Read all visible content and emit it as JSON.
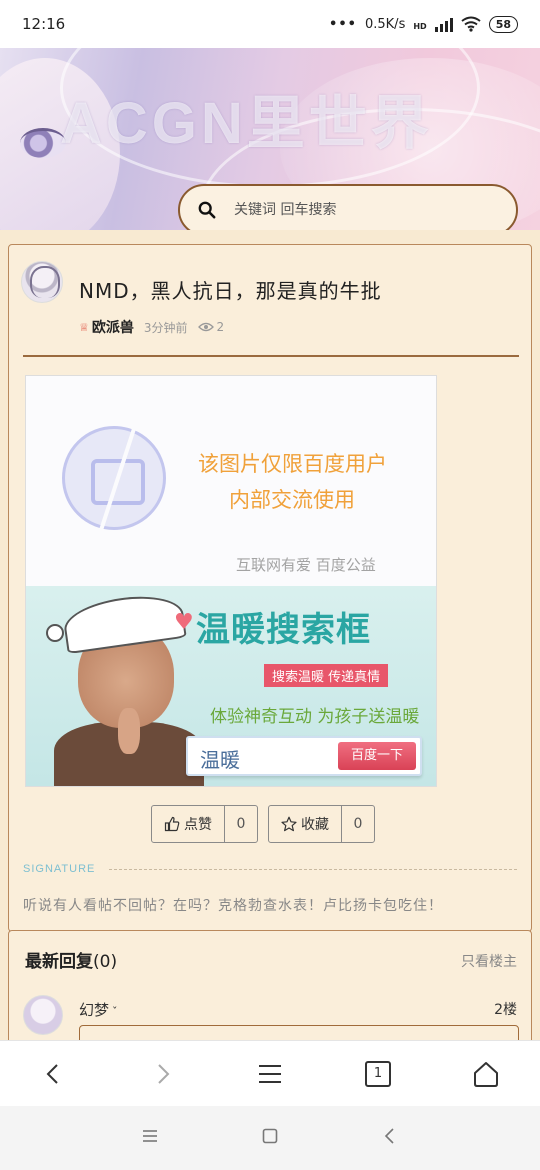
{
  "status_bar": {
    "time": "12:16",
    "network_speed": "0.5K/s",
    "network_type": "HD",
    "battery": "58"
  },
  "banner": {
    "wordmark": "ACGN里世界",
    "search_placeholder": "关键词 回车搜索"
  },
  "post": {
    "title": "NMD，黑人抗日，那是真的牛批",
    "author": "欧派兽",
    "time_ago": "3分钟前",
    "views": "2",
    "ad_image": {
      "notice_line1": "该图片仅限百度用户",
      "notice_line2": "内部交流使用",
      "notice_footer": "互联网有爱  百度公益",
      "campaign_title": "温暖搜索框",
      "campaign_badge": "搜索温暖 传递真情",
      "campaign_subtitle": "体验神奇互动 为孩子送温暖",
      "search_text": "温暖",
      "search_button": "百度一下"
    },
    "actions": {
      "like_label": "点赞",
      "like_count": "0",
      "favorite_label": "收藏",
      "favorite_count": "0"
    },
    "signature_label": "SIGNATURE",
    "signature_text": "听说有人看帖不回帖？在吗？克格勃查水表！卢比扬卡包吃住！"
  },
  "replies": {
    "heading": "最新回复",
    "count": "(0)",
    "only_op_label": "只看楼主",
    "items": [
      {
        "name": "幻梦",
        "floor": "2楼"
      }
    ]
  },
  "browser_bar": {
    "tab_count": "1"
  },
  "colors": {
    "page_bg": "#f8ead2",
    "card_border": "#b9885c",
    "search_border": "#8a5a2f",
    "signature_accent": "#7dbfd1"
  },
  "icons": [
    "search-icon",
    "eye-icon",
    "crown-icon",
    "thumbs-up-icon",
    "star-icon",
    "back-icon",
    "forward-icon",
    "menu-icon",
    "tabs-icon",
    "home-icon"
  ]
}
